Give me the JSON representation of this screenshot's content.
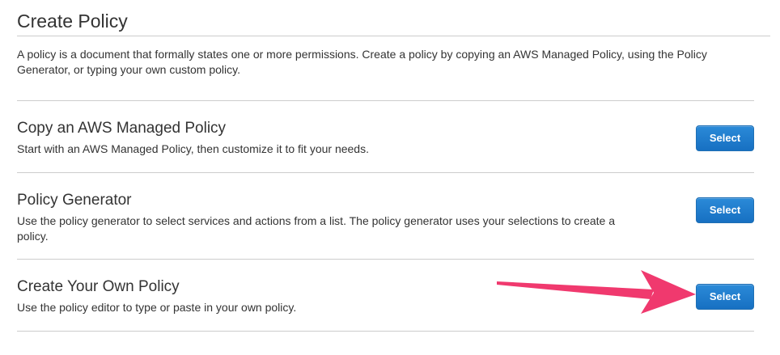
{
  "page": {
    "title": "Create Policy",
    "intro": "A policy is a document that formally states one or more permissions. Create a policy by copying an AWS Managed Policy, using the Policy Generator, or typing your own custom policy."
  },
  "options": [
    {
      "title": "Copy an AWS Managed Policy",
      "description": "Start with an AWS Managed Policy, then customize it to fit your needs.",
      "button_label": "Select"
    },
    {
      "title": "Policy Generator",
      "description": "Use the policy generator to select services and actions from a list. The policy generator uses your selections to create a policy.",
      "button_label": "Select"
    },
    {
      "title": "Create Your Own Policy",
      "description": "Use the policy editor to type or paste in your own policy.",
      "button_label": "Select"
    }
  ],
  "annotation": {
    "icon": "pointer-arrow-icon",
    "color": "#f0396e"
  },
  "colors": {
    "button": "#1a75c7",
    "text": "#333333",
    "rule": "#cccccc"
  }
}
